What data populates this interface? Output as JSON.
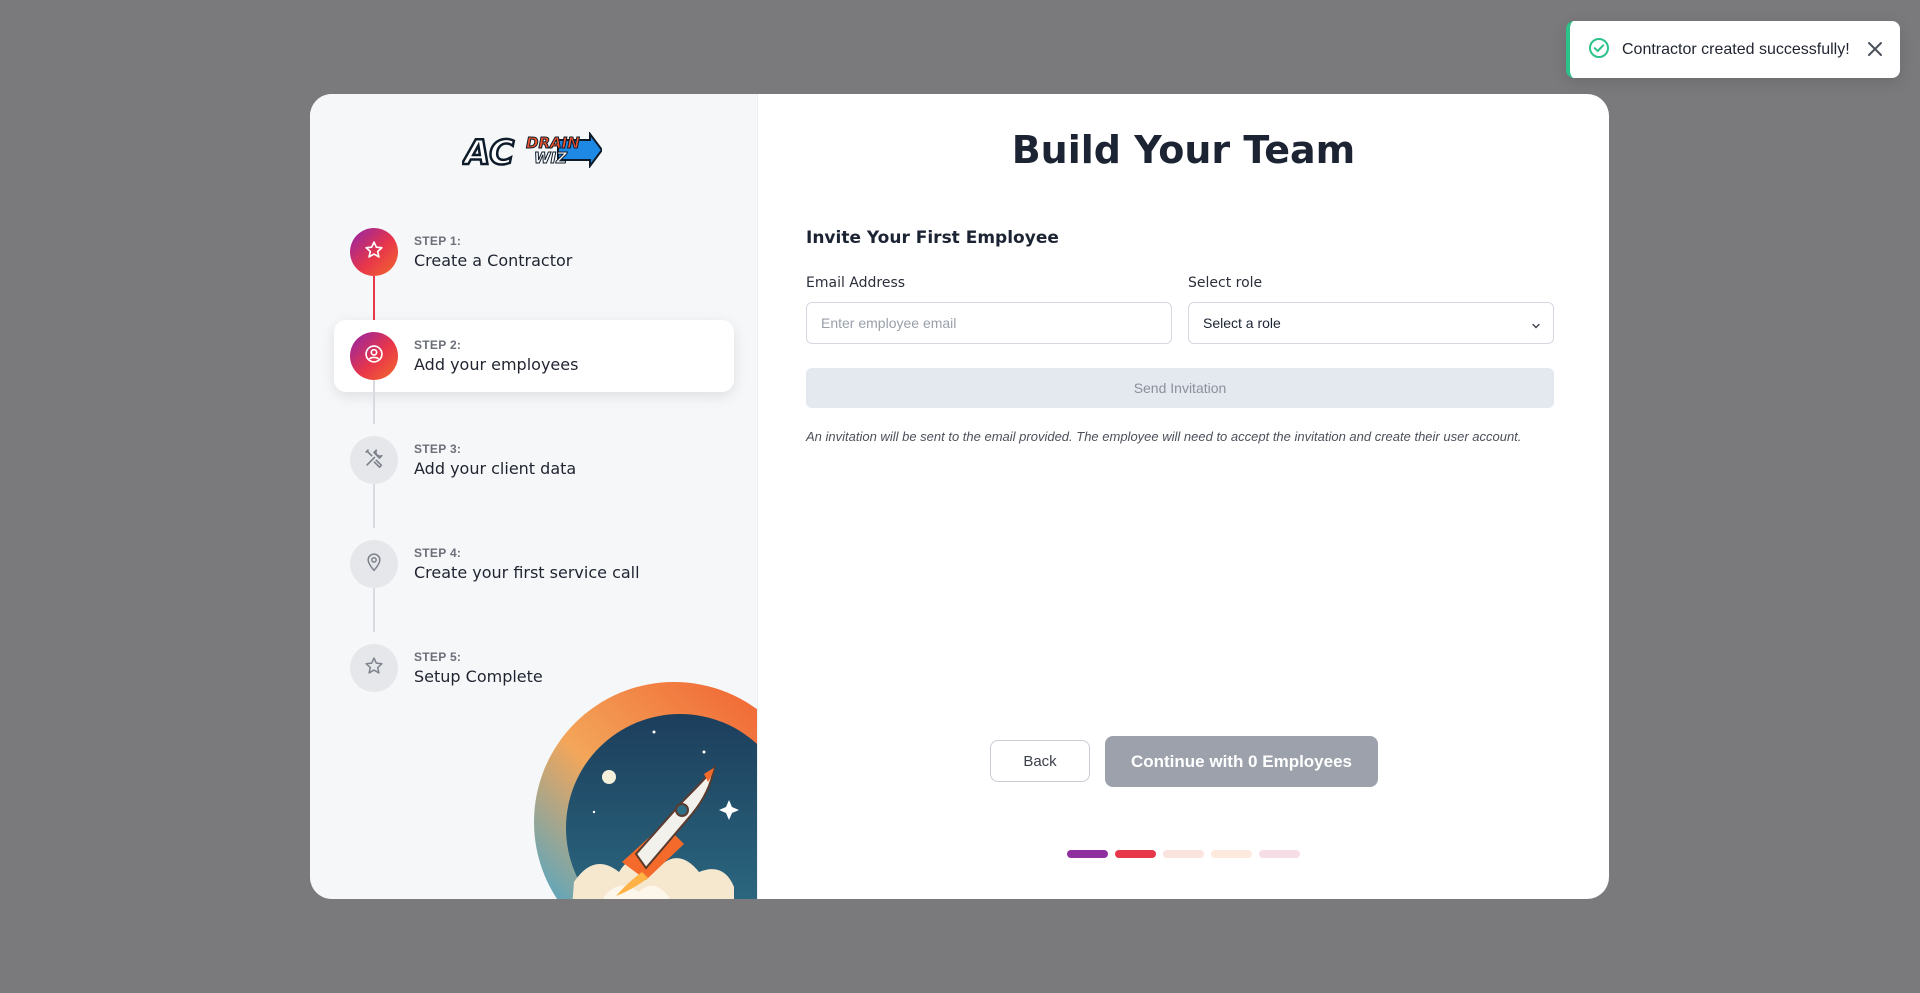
{
  "toast": {
    "message": "Contractor created successfully!",
    "icon": "check-circle-icon",
    "accent": "#2cc28a"
  },
  "sidebar": {
    "logo_text": [
      "AC",
      "DRAIN",
      "WIZ"
    ],
    "steps": [
      {
        "num": "STEP 1:",
        "label": "Create a Contractor",
        "icon": "star-icon",
        "state": "done"
      },
      {
        "num": "STEP 2:",
        "label": "Add your employees",
        "icon": "user-circle-icon",
        "state": "current"
      },
      {
        "num": "STEP 3:",
        "label": "Add your client data",
        "icon": "tools-icon",
        "state": "pending"
      },
      {
        "num": "STEP 4:",
        "label": "Create your first service call",
        "icon": "map-pin-icon",
        "state": "pending"
      },
      {
        "num": "STEP 5:",
        "label": "Setup Complete",
        "icon": "star-icon",
        "state": "pending"
      }
    ]
  },
  "main": {
    "title": "Build Your Team",
    "subtitle": "Invite Your First Employee",
    "email": {
      "label": "Email Address",
      "placeholder": "Enter employee email",
      "value": ""
    },
    "role": {
      "label": "Select role",
      "selected": "Select a role"
    },
    "send_label": "Send Invitation",
    "note": "An invitation will be sent to the email provided. The employee will need to accept the invitation and create their user account.",
    "back_label": "Back",
    "continue_label": "Continue with 0 Employees"
  },
  "progress": {
    "total": 5,
    "current": 2,
    "colors": [
      "#8e2fa0",
      "#e8364a",
      "#fbe3df",
      "#fde9de",
      "#f7dde5"
    ]
  }
}
